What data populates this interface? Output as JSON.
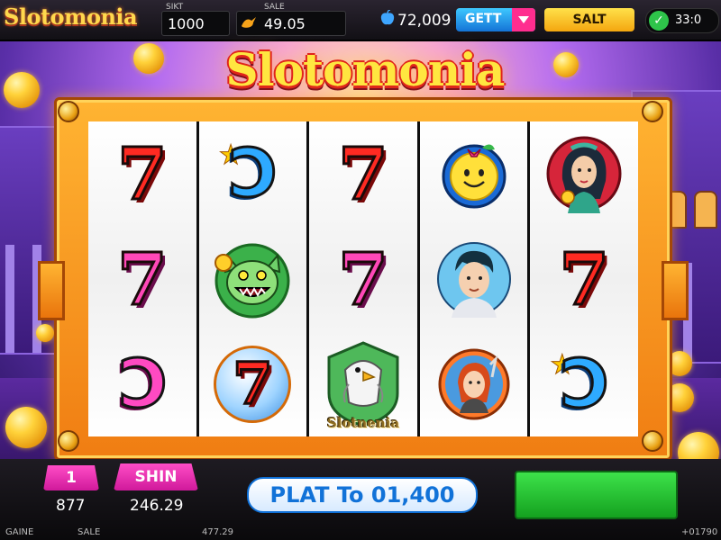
{
  "app": {
    "logo": "Slotomonia",
    "banner_title": "Slotomonia"
  },
  "topbar": {
    "stat1": {
      "label": "SIKT",
      "value": "1000"
    },
    "stat2": {
      "label": "SALE",
      "value": "49.05"
    },
    "gems": "72,009",
    "get_button": "GETT",
    "salt_button": "SALT",
    "timer": "33:0"
  },
  "reels": [
    [
      {
        "symbol": "seven",
        "color": "red"
      },
      {
        "symbol": "seven",
        "color": "pink"
      },
      {
        "symbol": "c",
        "color": "pink"
      }
    ],
    [
      {
        "symbol": "c",
        "color": "blue",
        "star": true
      },
      {
        "symbol": "cat",
        "label": ""
      },
      {
        "symbol": "seven-badge",
        "color": "red"
      }
    ],
    [
      {
        "symbol": "seven",
        "color": "red"
      },
      {
        "symbol": "seven",
        "color": "pink"
      },
      {
        "symbol": "eagle",
        "label": "Slotnenia"
      }
    ],
    [
      {
        "symbol": "smiley"
      },
      {
        "symbol": "boy-portrait"
      },
      {
        "symbol": "girl-portrait"
      }
    ],
    [
      {
        "symbol": "woman-portrait"
      },
      {
        "symbol": "seven",
        "color": "red"
      },
      {
        "symbol": "c",
        "color": "blue",
        "star": true
      }
    ]
  ],
  "bottombar": {
    "left_tab": "1",
    "left_value": "877",
    "shin_tab": "SHIN",
    "shin_value": "246.29",
    "plat_button": "PLAT To 01,400",
    "footer": {
      "gaine": "GAINE",
      "sale": "SALE",
      "mid": "477.29",
      "right": "+01790"
    }
  },
  "colors": {
    "accent_orange": "#f07d12",
    "gold": "#ffd84d",
    "pink": "#ff48b8",
    "blue": "#2eaaff",
    "green": "#14a11f"
  }
}
